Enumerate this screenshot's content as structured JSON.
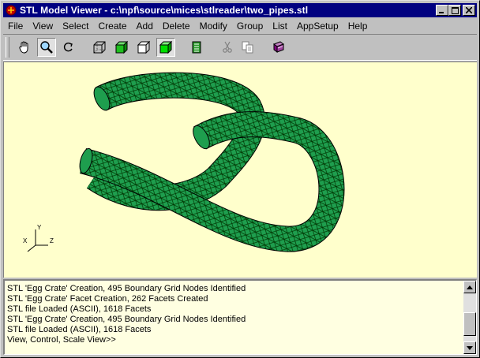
{
  "window": {
    "title": "STL Model Viewer - c:\\npf\\source\\mices\\stlreader\\two_pipes.stl"
  },
  "menu": {
    "items": [
      "File",
      "View",
      "Select",
      "Create",
      "Add",
      "Delete",
      "Modify",
      "Group",
      "List",
      "AppSetup",
      "Help"
    ]
  },
  "toolbar": {
    "buttons": [
      {
        "icon": "hand-pan-icon",
        "pressed": false
      },
      {
        "icon": "zoom-magnifier-icon",
        "pressed": true
      },
      {
        "icon": "rotate-icon",
        "pressed": false
      },
      {
        "icon": "wireframe-cube-icon",
        "pressed": false
      },
      {
        "icon": "shaded-cube-icon",
        "pressed": false
      },
      {
        "icon": "hidden-line-cube-icon",
        "pressed": false
      },
      {
        "icon": "solid-cube-icon",
        "pressed": true
      },
      {
        "icon": "facet-list-icon",
        "pressed": false
      },
      {
        "icon": "cut-icon",
        "pressed": false
      },
      {
        "icon": "copy-icon",
        "pressed": false
      },
      {
        "icon": "help-book-icon",
        "pressed": false
      }
    ]
  },
  "viewport": {
    "background": "#ffffcc",
    "model_color": "#1e9e4e",
    "axis_labels": {
      "x": "X",
      "y": "Y",
      "z": "Z"
    }
  },
  "log": {
    "lines": [
      "STL 'Egg Crate' Creation, 495 Boundary Grid Nodes Identified",
      "STL 'Egg Crate' Facet Creation, 262 Facets Created",
      "STL file Loaded (ASCII), 1618 Facets",
      "STL 'Egg Crate' Creation, 495 Boundary Grid Nodes Identified",
      "STL file Loaded (ASCII), 1618 Facets",
      "View, Control, Scale View>>"
    ]
  }
}
